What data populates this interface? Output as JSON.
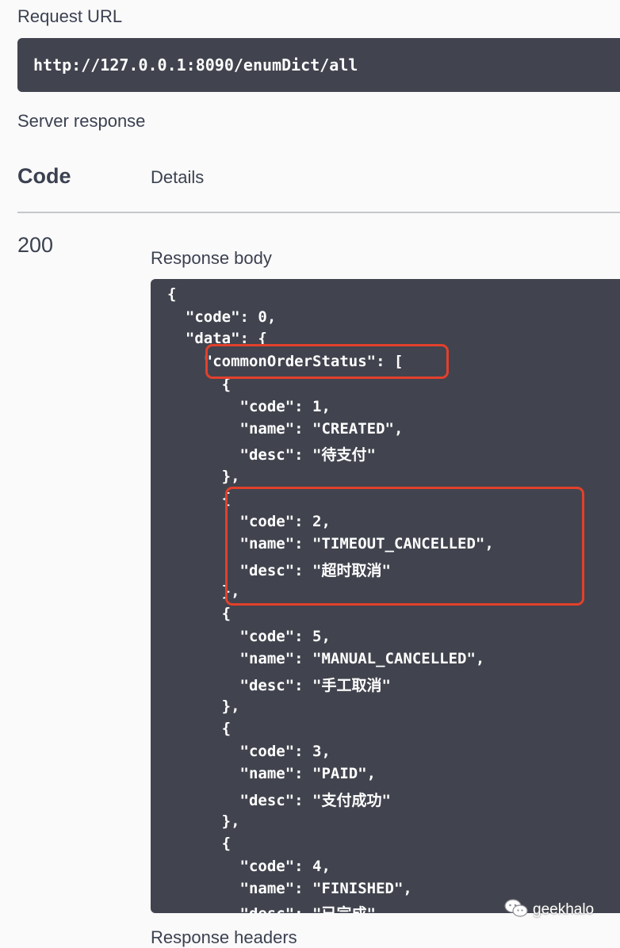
{
  "request": {
    "label": "Request URL",
    "url": "http://127.0.0.1:8090/enumDict/all"
  },
  "server_response": {
    "label": "Server response",
    "code_header": "Code",
    "details_header": "Details",
    "status_code": "200",
    "body_label": "Response body",
    "footer_label": "Response headers"
  },
  "response_body": {
    "lines": [
      "{",
      "  \"code\": 0,",
      "  \"data\": {",
      "    \"commonOrderStatus\": [",
      "      {",
      "        \"code\": 1,",
      "        \"name\": \"CREATED\",",
      "        \"desc\": \"待支付\"",
      "      },",
      "      {",
      "        \"code\": 2,",
      "        \"name\": \"TIMEOUT_CANCELLED\",",
      "        \"desc\": \"超时取消\"",
      "      },",
      "      {",
      "        \"code\": 5,",
      "        \"name\": \"MANUAL_CANCELLED\",",
      "        \"desc\": \"手工取消\"",
      "      },",
      "      {",
      "        \"code\": 3,",
      "        \"name\": \"PAID\",",
      "        \"desc\": \"支付成功\"",
      "      },",
      "      {",
      "        \"code\": 4,",
      "        \"name\": \"FINISHED\",",
      "        \"desc\": \"已完成\""
    ]
  },
  "watermark": {
    "text": "geekhalo",
    "icon": "wechat-icon"
  },
  "colors": {
    "background": "#fafafa",
    "code_background": "#41444e",
    "highlight": "#e2402c",
    "text": "#3b4151"
  }
}
